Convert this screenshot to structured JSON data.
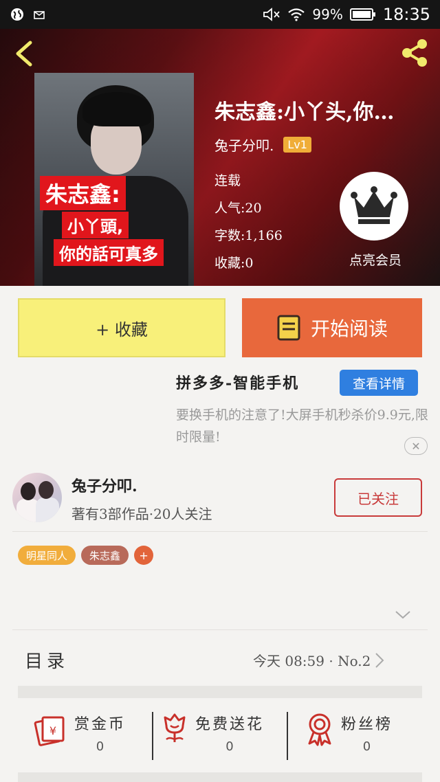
{
  "status_bar": {
    "battery_percent": "99%",
    "time": "18:35"
  },
  "book": {
    "title": "朱志鑫:小丫头,你…",
    "cover": {
      "tag1": "朱志鑫:",
      "tag2": "小丫頭,",
      "tag3": "你的話可真多"
    },
    "author": "兔子分叩.",
    "author_level": "Lv1",
    "status": "连载",
    "popularity": "人气:20",
    "word_count": "字数:1,166",
    "favorites": "收藏:0",
    "vip_label": "点亮会员"
  },
  "actions": {
    "favorite_label": "+ 收藏",
    "read_label": "开始阅读"
  },
  "ad": {
    "title": "拼多多-智能手机",
    "button": "查看详情",
    "description": "要换手机的注意了!大屏手机秒杀价9.9元,限时限量!",
    "close": "✕"
  },
  "author_card": {
    "name": "兔子分叩.",
    "stats": "著有3部作品·20人关注",
    "follow_label": "已关注"
  },
  "tags": [
    {
      "label": "明星同人",
      "color": "#f1ad3c"
    },
    {
      "label": "朱志鑫",
      "color": "#b86a5a"
    }
  ],
  "tag_add": "+",
  "toc": {
    "label": "目录",
    "latest": "今天 08:59 · No.2"
  },
  "stats": [
    {
      "label": "赏金币",
      "value": "0",
      "icon": "red-envelope-icon"
    },
    {
      "label": "免费送花",
      "value": "0",
      "icon": "flower-icon"
    },
    {
      "label": "粉丝榜",
      "value": "0",
      "icon": "medal-icon"
    }
  ],
  "colors": {
    "accent_red": "#c83a3a",
    "read_orange": "#e8683c",
    "favorite_yellow": "#f8f07a",
    "ad_blue": "#2f7fe0"
  }
}
